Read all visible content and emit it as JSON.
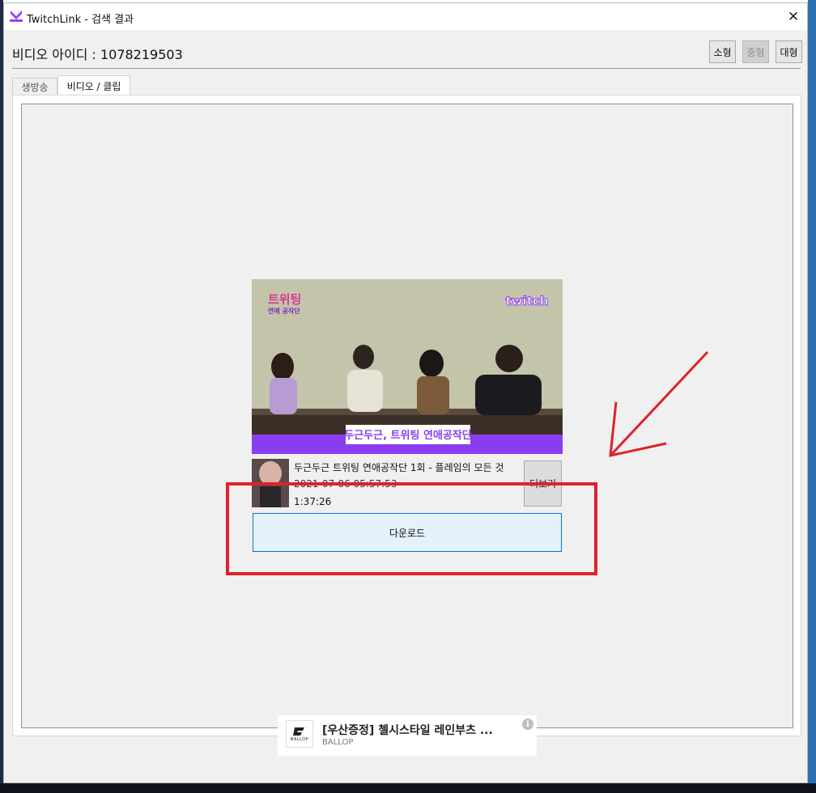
{
  "window": {
    "title": "TwitchLink - 검색 결과",
    "close_glyph": "✕"
  },
  "header": {
    "video_id_label": "비디오 아이디 : 1078219503",
    "size_buttons": [
      {
        "label": "소형",
        "enabled": true
      },
      {
        "label": "중형",
        "enabled": false
      },
      {
        "label": "대형",
        "enabled": true
      }
    ]
  },
  "tabs": [
    {
      "label": "생방송",
      "active": false
    },
    {
      "label": "비디오 / 클립",
      "active": true
    }
  ],
  "video": {
    "thumbnail": {
      "banner_text": "두근두근, 트위팅 연애공작단",
      "logo_text": "twitch",
      "show_title": "트위팅",
      "show_subtitle": "연애 공작단"
    },
    "title": "두근두근 트위팅 연애공작단 1회 - 플레임의 모든 것",
    "date": "2021-07-06 05:57:53",
    "duration": "1:37:26",
    "more_button": "더보기",
    "download_button": "다운로드"
  },
  "ad": {
    "title": "[우산증정] 첼시스타일 레인부츠 ...",
    "advertiser": "BALLOP",
    "logo_text": "BALLOP",
    "info_icon": "info-icon"
  },
  "colors": {
    "accent_purple": "#9146ff",
    "annotation_red": "#e0202a",
    "download_border": "#0078d7"
  }
}
